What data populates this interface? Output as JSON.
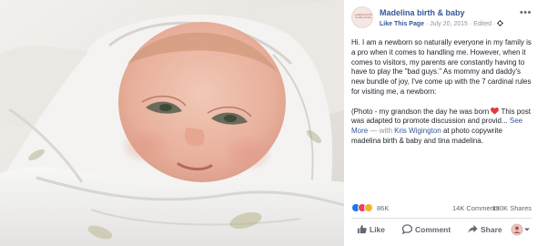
{
  "post": {
    "page_name": "Madelina birth & baby",
    "like_page": "Like This Page",
    "separator": "·",
    "date": "July 20, 2015",
    "edited": "Edited",
    "more_menu": "•••",
    "avatar_text": "madelina birth & baby doula",
    "text": {
      "paragraph1": "Hi. I am a newborn so naturally everyone in my family is a pro when it comes to handling me. However, when it comes to visitors, my parents are constantly having to have to play the \"bad guys.\" As mommy and daddy's new bundle of joy, I've come up with the 7 cardinal rules for visiting me, a newborn:",
      "paragraph2_start": "(Photo - my grandson the day he was born ",
      "paragraph2_end": " This post was adapted to promote discussion and provid...",
      "see_more": "See More",
      "with_prefix": "— with",
      "tagged_person": "Kris Wigington",
      "tail": "at photo copywrite madelina birth & baby and tina madelina."
    }
  },
  "stats": {
    "reactions_count": "86K",
    "comments": "14K Comments",
    "shares": "130K Shares"
  },
  "actions": {
    "like": "Like",
    "comment": "Comment",
    "share": "Share"
  },
  "colors": {
    "link_blue": "#365899",
    "meta_gray": "#90949c",
    "action_gray": "#606770",
    "like_blue": "#1877f2",
    "love_red": "#f33e58",
    "haha_yellow": "#f7b125"
  }
}
